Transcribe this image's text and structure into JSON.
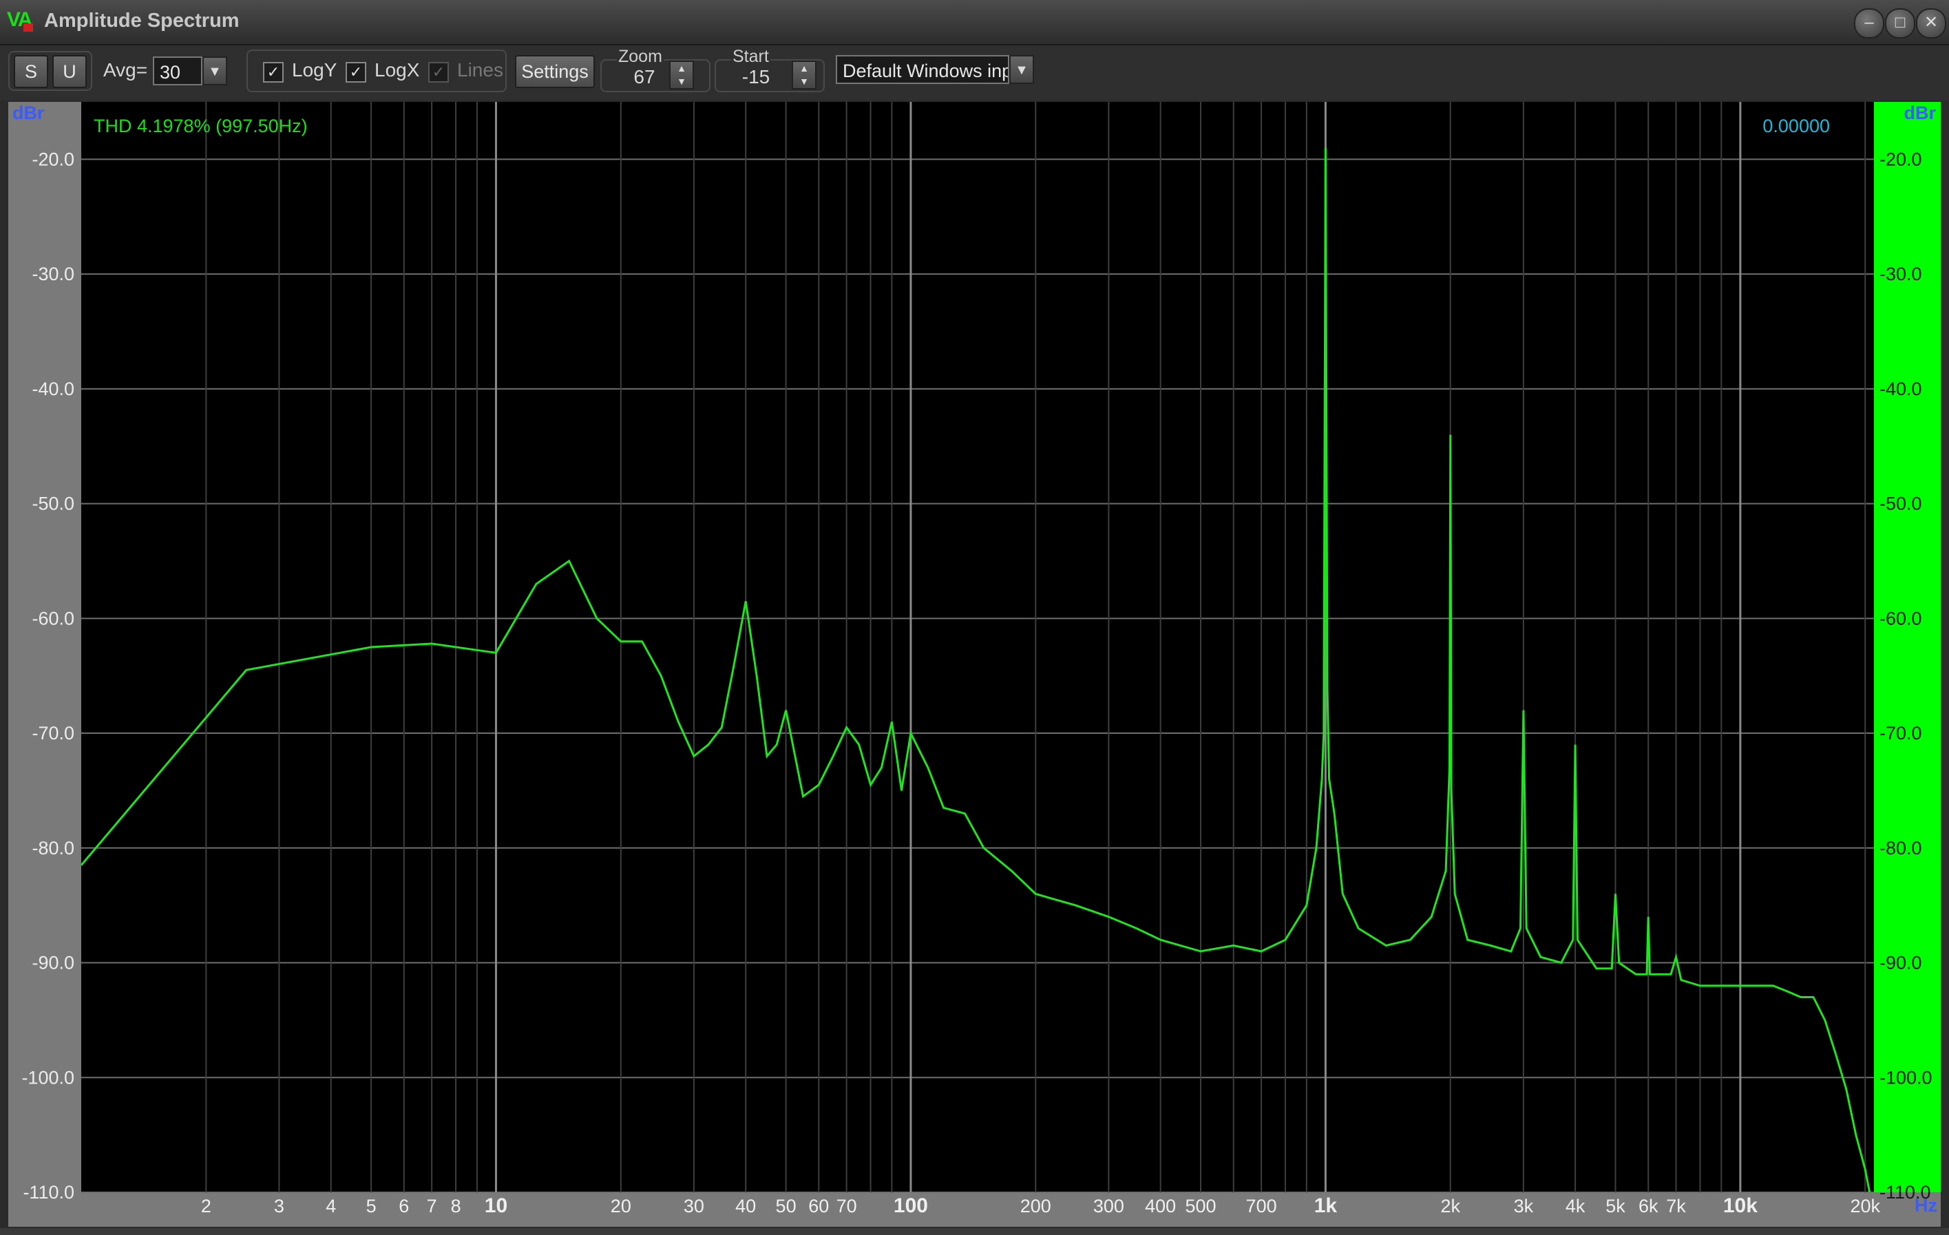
{
  "window": {
    "title": "Amplitude Spectrum"
  },
  "toolbar": {
    "s_label": "S",
    "u_label": "U",
    "avg_label": "Avg=",
    "avg_value": "30",
    "logy_label": "LogY",
    "logy_checked": true,
    "logx_label": "LogX",
    "logx_checked": true,
    "lines_label": "Lines",
    "lines_checked": true,
    "settings_label": "Settings",
    "zoom_label": "Zoom",
    "zoom_value": "67",
    "start_label": "Start",
    "start_value": "-15",
    "input_device": "Default Windows inp"
  },
  "readouts": {
    "thd": "THD 4.1978% (997.50Hz)",
    "value": "0.00000"
  },
  "colors": {
    "trace": "#1fe51f",
    "level_bar": "#00ff00",
    "grid": "#6e6e6e",
    "unit_label": "#3a5cff",
    "readout_value": "#20b8d8",
    "thd_text": "#19e019"
  },
  "level_meter": {
    "fill_fraction": 1.0
  },
  "chart_data": {
    "type": "line",
    "xlabel": "Hz",
    "ylabel": "dBr",
    "ylabel_right": "dBr",
    "xscale": "log",
    "xlim": [
      1,
      21000
    ],
    "ylim": [
      -110,
      -15
    ],
    "grid": true,
    "y_ticks": [
      -20,
      -30,
      -40,
      -50,
      -60,
      -70,
      -80,
      -90,
      -100,
      -110
    ],
    "y_tick_labels": [
      "-20.0",
      "-30.0",
      "-40.0",
      "-50.0",
      "-60.0",
      "-70.0",
      "-80.0",
      "-90.0",
      "-100.0",
      "-110.0"
    ],
    "x_ticks": [
      2,
      3,
      4,
      5,
      6,
      7,
      8,
      10,
      20,
      30,
      40,
      50,
      60,
      70,
      100,
      200,
      300,
      400,
      500,
      700,
      1000,
      2000,
      3000,
      4000,
      5000,
      6000,
      7000,
      10000,
      20000
    ],
    "x_tick_labels": [
      "2",
      "3",
      "4",
      "5",
      "6",
      "7",
      "8",
      "10",
      "20",
      "30",
      "40",
      "50",
      "60",
      "70",
      "100",
      "200",
      "300",
      "400",
      "500",
      "700",
      "1k",
      "2k",
      "3k",
      "4k",
      "5k",
      "6k",
      "7k",
      "10k",
      "20k"
    ],
    "x_major_ticks": [
      10,
      100,
      1000,
      10000
    ],
    "series": [
      {
        "x": [
          1,
          2.5,
          5,
          7,
          10,
          12.5,
          15,
          17.5,
          20,
          22.5,
          25,
          27.5,
          30,
          32.5,
          35,
          37.5,
          40,
          42.5,
          45,
          47.5,
          50,
          55,
          60,
          65,
          70,
          75,
          80,
          85,
          90,
          95,
          100,
          110,
          120,
          135,
          150,
          175,
          200,
          250,
          300,
          350,
          400,
          500,
          600,
          700,
          800,
          900,
          950,
          980,
          990,
          1000,
          1010,
          1020,
          1050,
          1100,
          1200,
          1400,
          1600,
          1800,
          1950,
          1990,
          2000,
          2010,
          2050,
          2200,
          2500,
          2800,
          2950,
          3000,
          3050,
          3300,
          3700,
          3950,
          4000,
          4050,
          4500,
          4900,
          5000,
          5100,
          5600,
          5950,
          6000,
          6050,
          6800,
          7000,
          7200,
          8000,
          9000,
          10000,
          11000,
          12000,
          13000,
          14000,
          15000,
          16000,
          17000,
          18000,
          19000,
          20000,
          20500
        ],
        "y": [
          -81.5,
          -64.5,
          -62.5,
          -62.2,
          -63,
          -57,
          -55,
          -60,
          -62,
          -62,
          -65,
          -69,
          -72,
          -71,
          -69.5,
          -64,
          -58.5,
          -65,
          -72,
          -71,
          -68,
          -75.5,
          -74.5,
          -72,
          -69.5,
          -71,
          -74.5,
          -73,
          -69,
          -75,
          -70,
          -73,
          -76.5,
          -77,
          -80,
          -82,
          -84,
          -85,
          -86,
          -87,
          -88,
          -89,
          -88.5,
          -89,
          -88,
          -85,
          -80,
          -74,
          -70,
          -19,
          -66,
          -74,
          -77,
          -84,
          -87,
          -88.5,
          -88,
          -86,
          -82,
          -73,
          -44,
          -75,
          -84,
          -88,
          -88.5,
          -89,
          -87,
          -68,
          -87,
          -89.5,
          -90,
          -88,
          -71,
          -88,
          -90.5,
          -90.5,
          -84,
          -90,
          -91,
          -91,
          -86,
          -91,
          -91,
          -89.5,
          -91.5,
          -92,
          -92,
          -92,
          -92,
          -92,
          -92.5,
          -93,
          -93,
          -95,
          -98,
          -101,
          -105,
          -108,
          -110
        ]
      }
    ]
  }
}
